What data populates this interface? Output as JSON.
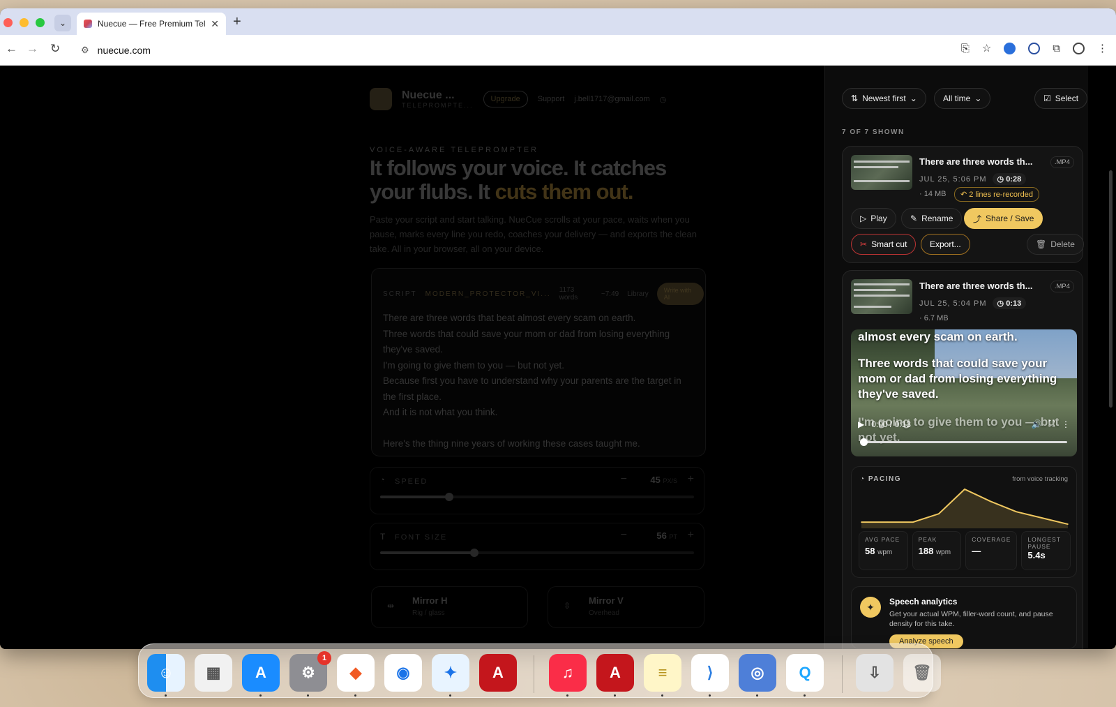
{
  "browser": {
    "tab_title": "Nuecue — Free Premium Tele",
    "url": "nuecue.com",
    "tab_dropdown": "⌄",
    "new_tab": "+",
    "close_tab": "✕"
  },
  "app": {
    "brand": "Nuecue ...",
    "brand_sub": "TELEPROMPTE...",
    "upgrade": "Upgrade",
    "support": "Support",
    "email": "j.bell1717@gmail.com",
    "kicker": "VOICE-AWARE TELEPROMPTER",
    "headline_1": "It follows your voice. It catches your flubs. It ",
    "headline_accent": "cuts them out.",
    "lead": "Paste your script and start talking. NueCue scrolls at your pace, waits when you pause, marks every line you redo, coaches your delivery — and exports the clean take. All in your browser, all on your device.",
    "script_label": "SCRIPT",
    "script_name": "MODERN_PROTECTOR_VI...",
    "word_count": "1173 words",
    "duration": "~7:49",
    "library": "Library",
    "write_ai": "Write with AI",
    "script_lines": [
      "There are three words that beat almost every scam on earth.",
      "Three words that could save your mom or dad from losing everything they've saved.",
      "I'm going to give them to you — but not yet.",
      "Because first you have to understand why your parents are the target in the first place.",
      "And it is not what you think.",
      "",
      "Here's the thing nine years of working these cases taught me."
    ],
    "speed_label": "SPEED",
    "speed_value": "45",
    "speed_unit": "PX/S",
    "speed_level": 0.22,
    "font_label": "FONT SIZE",
    "font_value": "56",
    "font_unit": "PT",
    "font_level": 0.3,
    "mirror_h": "Mirror H",
    "mirror_h_sub": "Rig / glass",
    "mirror_v": "Mirror V",
    "mirror_v_sub": "Overhead"
  },
  "panel": {
    "sort": "Newest first",
    "range": "All time",
    "select": "Select",
    "shown": "7 OF 7 SHOWN",
    "recordings": [
      {
        "title": "There are three words th...",
        "format": ".MP4",
        "date": "JUL 25, 5:06 PM",
        "duration": "0:28",
        "size": "· 14 MB",
        "rerecorded": "2 lines re-recorded",
        "play": "Play",
        "rename": "Rename",
        "share": "Share / Save",
        "smart_cut": "Smart cut",
        "export": "Export...",
        "delete": "Delete"
      },
      {
        "title": "There are three words th...",
        "format": ".MP4",
        "date": "JUL 25, 5:04 PM",
        "duration": "0:13",
        "size": "· 6.7 MB",
        "captions": [
          "almost every scam on earth.",
          "Three words that could save your mom or dad from losing everything they've saved.",
          "I'm going to give them to you — but not yet."
        ],
        "time_display": "0:00 / 0:13",
        "playback": 0
      }
    ],
    "pacing": {
      "title": "PACING",
      "source": "from voice tracking",
      "stats": [
        {
          "label": "AVG PACE",
          "value": "58",
          "unit": "wpm"
        },
        {
          "label": "PEAK",
          "value": "188",
          "unit": "wpm"
        },
        {
          "label": "COVERAGE",
          "value": "—",
          "unit": ""
        },
        {
          "label": "LONGEST PAUSE",
          "value": "5.4s",
          "unit": ""
        }
      ]
    },
    "speech": {
      "title": "Speech analytics",
      "desc": "Get your actual WPM, filler-word count, and pause density for this take.",
      "button": "Analyze speech"
    }
  },
  "chart_data": {
    "type": "area",
    "x": [
      0,
      1,
      2,
      3,
      4,
      5,
      6,
      7,
      8
    ],
    "values": [
      30,
      30,
      30,
      70,
      188,
      130,
      80,
      50,
      20
    ],
    "color": "#f0c860"
  },
  "dock": {
    "apps": [
      "finder-icon",
      "launchpad-icon",
      "app-store-icon",
      "system-settings-icon",
      "brave-icon",
      "chrome-icon",
      "safari-icon",
      "acrobat-icon",
      "music-icon",
      "acrobat-reader-icon",
      "notes-icon",
      "vscode-icon",
      "finder-alt-icon",
      "quicktime-icon",
      "downloads-icon",
      "trash-icon"
    ],
    "settings_badge": "1"
  },
  "colors": {
    "accent": "#f0c860",
    "danger": "#e04040",
    "bg": "#0c0c0c"
  }
}
